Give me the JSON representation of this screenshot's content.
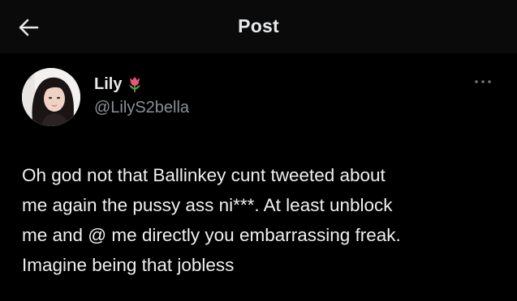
{
  "header": {
    "title": "Post",
    "back_icon": "arrow-left-icon"
  },
  "post": {
    "author": {
      "display_name": "Lily",
      "handle": "@LilyS2bella",
      "name_emoji": "tulip-icon",
      "avatar_icon": "avatar-photo"
    },
    "more_icon": "more-dots-icon",
    "text_lines": [
      "Oh god not that Ballinkey cunt tweeted about",
      "me again the pussy ass ni***. At least unblock",
      "me and @ me directly you embarrassing freak.",
      "Imagine being that jobless"
    ]
  },
  "colors": {
    "background": "#000000",
    "header_background": "#0a0a0b",
    "primary_text": "#e7e9ea",
    "secondary_text": "#8b9096",
    "tulip_pink": "#e8557a"
  }
}
